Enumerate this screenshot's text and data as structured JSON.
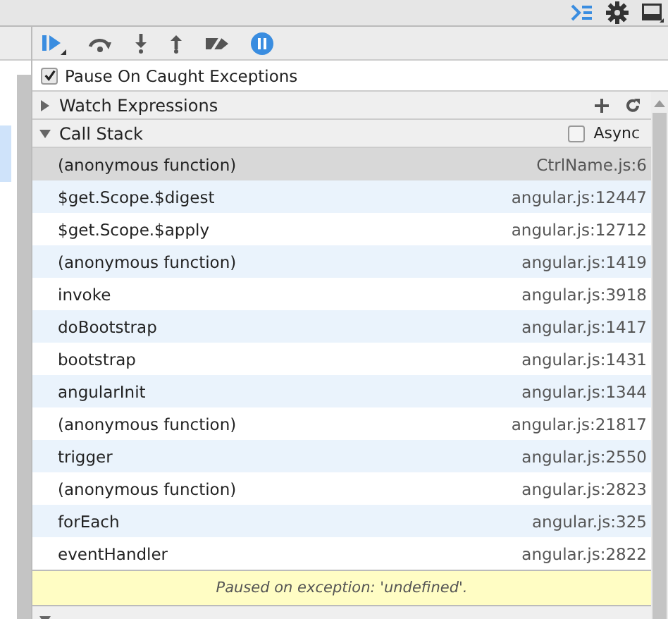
{
  "toolbar": {
    "buttons": [
      {
        "kind": "resume"
      },
      {
        "kind": "step-over"
      },
      {
        "kind": "step-into"
      },
      {
        "kind": "step-out"
      },
      {
        "kind": "deactivate"
      },
      {
        "kind": "pause"
      }
    ]
  },
  "pause_on_caught": {
    "label": "Pause On Caught Exceptions",
    "checked": true
  },
  "watch_expressions": {
    "title": "Watch Expressions",
    "expanded": false
  },
  "call_stack": {
    "title": "Call Stack",
    "expanded": true,
    "async": {
      "label": "Async",
      "checked": false
    },
    "frames": [
      {
        "name": "(anonymous function)",
        "location": "CtrlName.js:6",
        "selected": true
      },
      {
        "name": "$get.Scope.$digest",
        "location": "angular.js:12447",
        "selected": false
      },
      {
        "name": "$get.Scope.$apply",
        "location": "angular.js:12712",
        "selected": false
      },
      {
        "name": "(anonymous function)",
        "location": "angular.js:1419",
        "selected": false
      },
      {
        "name": "invoke",
        "location": "angular.js:3918",
        "selected": false
      },
      {
        "name": "doBootstrap",
        "location": "angular.js:1417",
        "selected": false
      },
      {
        "name": "bootstrap",
        "location": "angular.js:1431",
        "selected": false
      },
      {
        "name": "angularInit",
        "location": "angular.js:1344",
        "selected": false
      },
      {
        "name": "(anonymous function)",
        "location": "angular.js:21817",
        "selected": false
      },
      {
        "name": "trigger",
        "location": "angular.js:2550",
        "selected": false
      },
      {
        "name": "(anonymous function)",
        "location": "angular.js:2823",
        "selected": false
      },
      {
        "name": "forEach",
        "location": "angular.js:325",
        "selected": false
      },
      {
        "name": "eventHandler",
        "location": "angular.js:2822",
        "selected": false
      }
    ],
    "message": "Paused on exception: 'undefined'."
  },
  "scope_variables": {
    "expanded": true
  }
}
